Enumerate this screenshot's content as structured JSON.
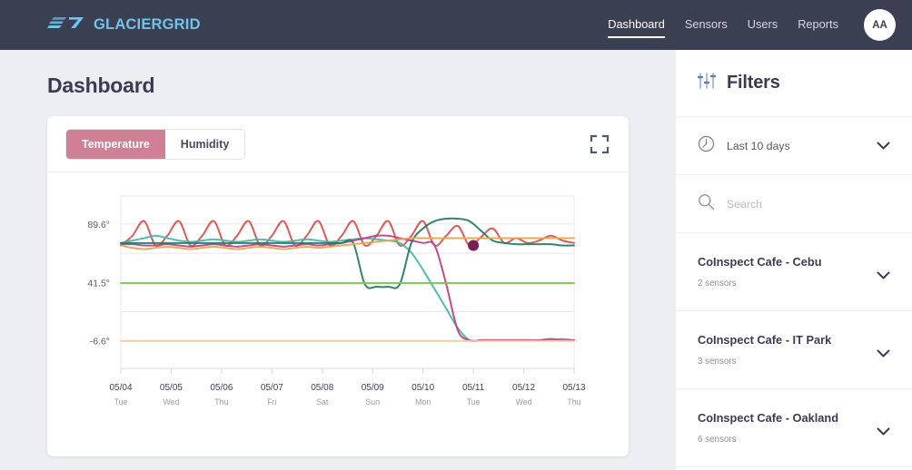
{
  "topbar": {
    "brand": "GLACIERGRID",
    "brand_icon": "glaciergrid-logo-icon",
    "brand_color": "#6fc4ee",
    "background": "#3b3f52",
    "nav": [
      {
        "label": "Dashboard",
        "active": true
      },
      {
        "label": "Sensors",
        "active": false
      },
      {
        "label": "Users",
        "active": false
      },
      {
        "label": "Reports",
        "active": false
      }
    ],
    "avatar": {
      "initials": "AA"
    }
  },
  "main": {
    "page_title": "Dashboard",
    "background": "#eceef1"
  },
  "card": {
    "tabs": [
      {
        "label": "Temperature",
        "active": true
      },
      {
        "label": "Humidity",
        "active": false
      }
    ],
    "active_tab_color": "#cf8095",
    "expand_icon": "fullscreen-expand-icon"
  },
  "sidebar": {
    "title": "Filters",
    "title_icon": "filter-sliders-icon",
    "date_filter": {
      "icon": "clock-icon",
      "value": "Last 10 days",
      "chevron": "chevron-down-icon"
    },
    "search": {
      "icon": "search-icon",
      "placeholder": "Search",
      "value": ""
    },
    "locations": [
      {
        "name": "CoInspect Cafe - Cebu",
        "count": "2 sensors",
        "chevron": "chevron-down-icon"
      },
      {
        "name": "CoInspect Cafe - IT Park",
        "count": "3 sensors",
        "chevron": "chevron-down-icon"
      },
      {
        "name": "CoInspect Cafe - Oakland",
        "count": "6 sensors",
        "chevron": "chevron-down-icon"
      }
    ]
  },
  "chart_data": {
    "type": "line",
    "title": "",
    "xlabel": "",
    "ylabel": "",
    "grid": true,
    "legend": "none",
    "ylim": [
      -29.2,
      112.7
    ],
    "yticks": [
      89.6,
      41.5,
      -6.6
    ],
    "ytick_labels": [
      "89.6°",
      "41.5°",
      "-6.6°"
    ],
    "gridline_values": [
      112.7,
      89.6,
      65.6,
      41.5,
      17.5,
      -6.6,
      -29.2
    ],
    "x": [
      "05/04",
      "05/05",
      "05/06",
      "05/07",
      "05/08",
      "05/09",
      "05/10",
      "05/11",
      "05/12",
      "05/13"
    ],
    "x_sublabels": [
      "Tue",
      "Wed",
      "Thu",
      "Fri",
      "Sat",
      "Sun",
      "Mon",
      "Tue",
      "Wed",
      "Thu"
    ],
    "marker": {
      "x": "05/11",
      "y": 72.0,
      "color": "#7b1f52",
      "radius": 6
    },
    "series": [
      {
        "name": "sensor-red",
        "color": "#d94f4a",
        "values": [
          72,
          80,
          92,
          72,
          80,
          92,
          72,
          80,
          92,
          72,
          80,
          92,
          72,
          80,
          92,
          72,
          80,
          92,
          72,
          80,
          92,
          72,
          80,
          92,
          72,
          80,
          92,
          72,
          80,
          88,
          72,
          79,
          86,
          74,
          78,
          74,
          76,
          80,
          76,
          74
        ]
      },
      {
        "name": "sensor-teal",
        "color": "#3fb8ac",
        "values": [
          74,
          76,
          78,
          80,
          78,
          76,
          75,
          76,
          77,
          76,
          75,
          76,
          77,
          76,
          75,
          76,
          77,
          76,
          75,
          76,
          77,
          78,
          77,
          76,
          74,
          66,
          52,
          36,
          20,
          4,
          -6,
          -6,
          -6,
          -6,
          -6,
          -6,
          -6,
          -6,
          -5,
          -6
        ]
      },
      {
        "name": "sensor-magenta",
        "color": "#c13b82",
        "values": [
          73,
          73,
          72,
          72,
          73,
          72,
          71,
          72,
          73,
          72,
          71,
          72,
          73,
          72,
          71,
          72,
          73,
          72,
          73,
          74,
          76,
          78,
          80,
          80,
          78,
          76,
          74,
          72,
          40,
          2,
          -6,
          -6,
          -6,
          -6,
          -6,
          -6,
          -6,
          -5,
          -6,
          -6
        ]
      },
      {
        "name": "sensor-darkgreen",
        "color": "#1f7a63",
        "values": [
          74,
          74,
          74,
          74,
          74,
          74,
          74,
          74,
          74,
          74,
          74,
          74,
          74,
          74,
          74,
          74,
          74,
          74,
          74,
          74,
          74,
          40,
          38,
          38,
          40,
          74,
          86,
          92,
          94,
          94,
          92,
          84,
          76,
          74,
          73,
          73,
          73,
          73,
          72,
          72
        ]
      },
      {
        "name": "sensor-orange",
        "color": "#e8a34e",
        "values": [
          72,
          70,
          69,
          70,
          71,
          70,
          69,
          70,
          71,
          70,
          69,
          70,
          71,
          70,
          69,
          70,
          71,
          70,
          71,
          72,
          73,
          74,
          75,
          76,
          77,
          78,
          78,
          78,
          78,
          78,
          78,
          78,
          78,
          78,
          78,
          78,
          78,
          78,
          78,
          78
        ]
      },
      {
        "name": "sensor-green-flat",
        "color": "#7ac943",
        "values": [
          41,
          41,
          41,
          41,
          41,
          41,
          41,
          41,
          41,
          41,
          41,
          41,
          41,
          41,
          41,
          41,
          41,
          41,
          41,
          41,
          41,
          41,
          41,
          41,
          41,
          41,
          41,
          41,
          41,
          41,
          41,
          41,
          41,
          41,
          41,
          41,
          41,
          41,
          41,
          41
        ]
      },
      {
        "name": "sensor-peach-flat",
        "color": "#f5c99b",
        "values": [
          -6.6,
          -6.6,
          -6.6,
          -6.6,
          -6.6,
          -6.6,
          -6.6,
          -6.6,
          -6.6,
          -6.6,
          -6.6,
          -6.6,
          -6.6,
          -6.6,
          -6.6,
          -6.6,
          -6.6,
          -6.6,
          -6.6,
          -6.6,
          -6.6,
          -6.6,
          -6.6,
          -6.6,
          -6.6,
          -6.6,
          -6.6,
          -6.6,
          -6.6,
          -6.6,
          -6.6,
          -6.6,
          -6.6,
          -6.6,
          -6.6,
          -6.6,
          -6.6,
          -6.6,
          -6.6,
          -6.6
        ]
      }
    ]
  }
}
